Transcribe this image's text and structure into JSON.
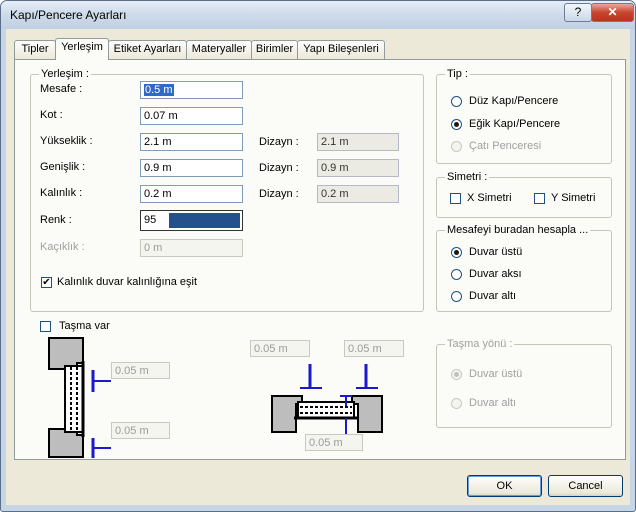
{
  "window": {
    "title": "Kapı/Pencere Ayarları",
    "help_label": "?",
    "close_label": "✕"
  },
  "tabs": [
    "Tipler",
    "Yerleşim",
    "Etiket Ayarları",
    "Materyaller",
    "Birimler",
    "Yapı Bileşenleri"
  ],
  "yerlesim": {
    "title": "Yerleşim :",
    "mesafe": {
      "label": "Mesafe :",
      "value": "0.5 m"
    },
    "kot": {
      "label": "Kot :",
      "value": "0.07 m"
    },
    "yukseklik": {
      "label": "Yükseklik :",
      "value": "2.1 m",
      "dizayn_label": "Dizayn :",
      "dizayn_value": "2.1 m"
    },
    "genislik": {
      "label": "Genişlik :",
      "value": "0.9 m",
      "dizayn_label": "Dizayn :",
      "dizayn_value": "0.9 m"
    },
    "kalinlik": {
      "label": "Kalınlık :",
      "value": "0.2 m",
      "dizayn_label": "Dizayn :",
      "dizayn_value": "0.2 m"
    },
    "renk": {
      "label": "Renk :",
      "value": "95",
      "color": "#24518c"
    },
    "kaciklik": {
      "label": "Kaçıklık :",
      "value": "0 m"
    },
    "kalinlik_duvar": {
      "label": "Kalınlık duvar kalınlığına eşit",
      "checked": true
    }
  },
  "tip": {
    "title": "Tip :",
    "options": [
      {
        "label": "Düz Kapı/Pencere",
        "selected": false,
        "enabled": true
      },
      {
        "label": "Eğik Kapı/Pencere",
        "selected": true,
        "enabled": true
      },
      {
        "label": "Çatı Penceresi",
        "selected": false,
        "enabled": false
      }
    ]
  },
  "simetri": {
    "title": "Simetri :",
    "x_label": "X Simetri",
    "y_label": "Y Simetri"
  },
  "mesafe_hesap": {
    "title": "Mesafeyi buradan hesapla ...",
    "options": [
      {
        "label": "Duvar üstü",
        "selected": true
      },
      {
        "label": "Duvar aksı",
        "selected": false
      },
      {
        "label": "Duvar altı",
        "selected": false
      }
    ]
  },
  "tasma": {
    "label": "Taşma var",
    "checked": false,
    "left_top_value": "0.05 m",
    "left_bottom_value": "0.05 m",
    "plan_left_value": "0.05 m",
    "plan_right_value": "0.05 m",
    "plan_bottom_value": "0.05 m"
  },
  "tasma_yonu": {
    "title": "Taşma yönü :",
    "options": [
      "Duvar üstü",
      "Duvar altı"
    ]
  },
  "buttons": {
    "ok": "OK",
    "cancel": "Cancel"
  }
}
